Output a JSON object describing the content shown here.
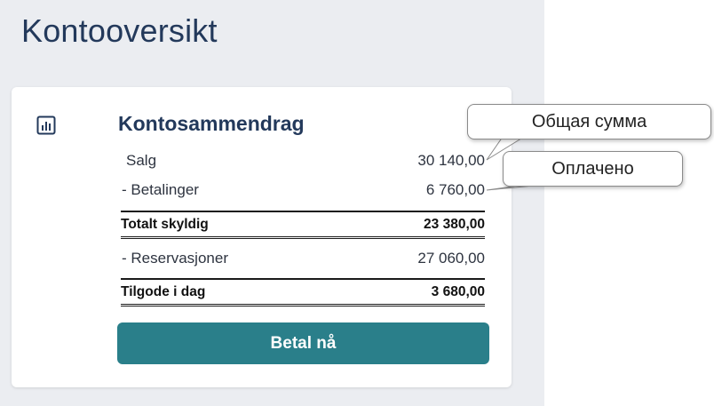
{
  "page": {
    "title": "Kontooversikt"
  },
  "summary": {
    "icon": "bar-chart-icon",
    "title": "Kontosammendrag",
    "rows": [
      {
        "label": "Salg",
        "amount": "30 140,00"
      },
      {
        "label": "- Betalinger",
        "amount": "6 760,00"
      },
      {
        "label": "Totalt skyldig",
        "amount": "23 380,00"
      },
      {
        "label": "- Reservasjoner",
        "amount": "27 060,00"
      },
      {
        "label": "Tilgode i dag",
        "amount": "3 680,00"
      }
    ],
    "pay_label": "Betal nå"
  },
  "annotations": {
    "total": "Общая сумма",
    "paid": "Оплачено"
  },
  "colors": {
    "accent": "#2a7f8a",
    "heading": "#23395b",
    "panel_background": "#ebedf1"
  }
}
